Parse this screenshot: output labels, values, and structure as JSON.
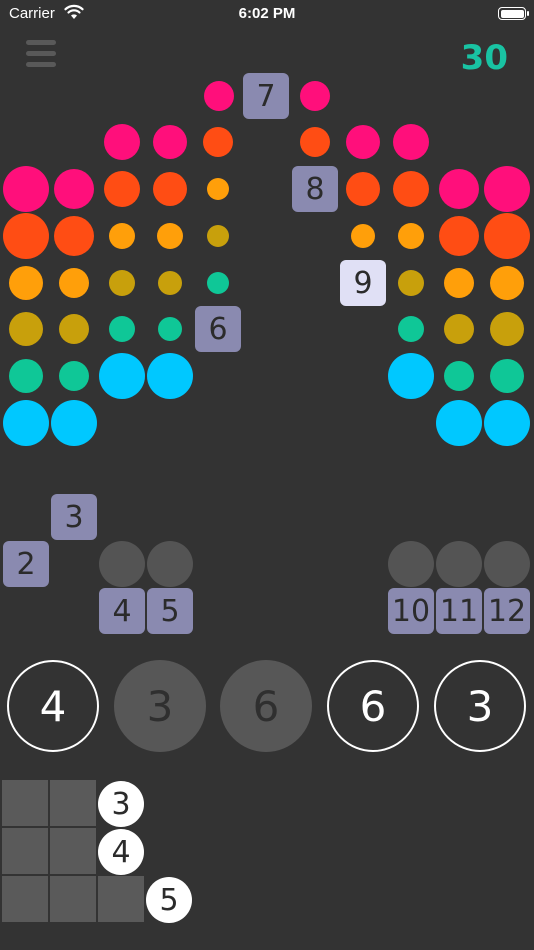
{
  "status_bar": {
    "carrier": "Carrier",
    "time": "6:02 PM"
  },
  "header": {
    "menu_icon": "hamburger-icon",
    "score": "30"
  },
  "colors": {
    "magenta": "#ff0f7b",
    "red": "#ff4d14",
    "orange": "#ff9f0a",
    "mustard": "#c8a00c",
    "teal": "#0fc797",
    "cyan": "#00c8ff",
    "tile": "#8a8ab0",
    "tile_active": "#e0e0f5",
    "score": "#19c3a3"
  },
  "board_tiles": [
    {
      "label": "7"
    },
    {
      "label": "8"
    },
    {
      "label": "9"
    },
    {
      "label": "6"
    },
    {
      "label": "3"
    },
    {
      "label": "2"
    },
    {
      "label": "4"
    },
    {
      "label": "5"
    },
    {
      "label": "10"
    },
    {
      "label": "11"
    },
    {
      "label": "12"
    }
  ],
  "choices": [
    {
      "label": "4",
      "style": "outline"
    },
    {
      "label": "3",
      "style": "filled"
    },
    {
      "label": "6",
      "style": "filled"
    },
    {
      "label": "6",
      "style": "outline"
    },
    {
      "label": "3",
      "style": "outline"
    }
  ],
  "counts": [
    {
      "label": "3"
    },
    {
      "label": "4"
    },
    {
      "label": "5"
    }
  ]
}
